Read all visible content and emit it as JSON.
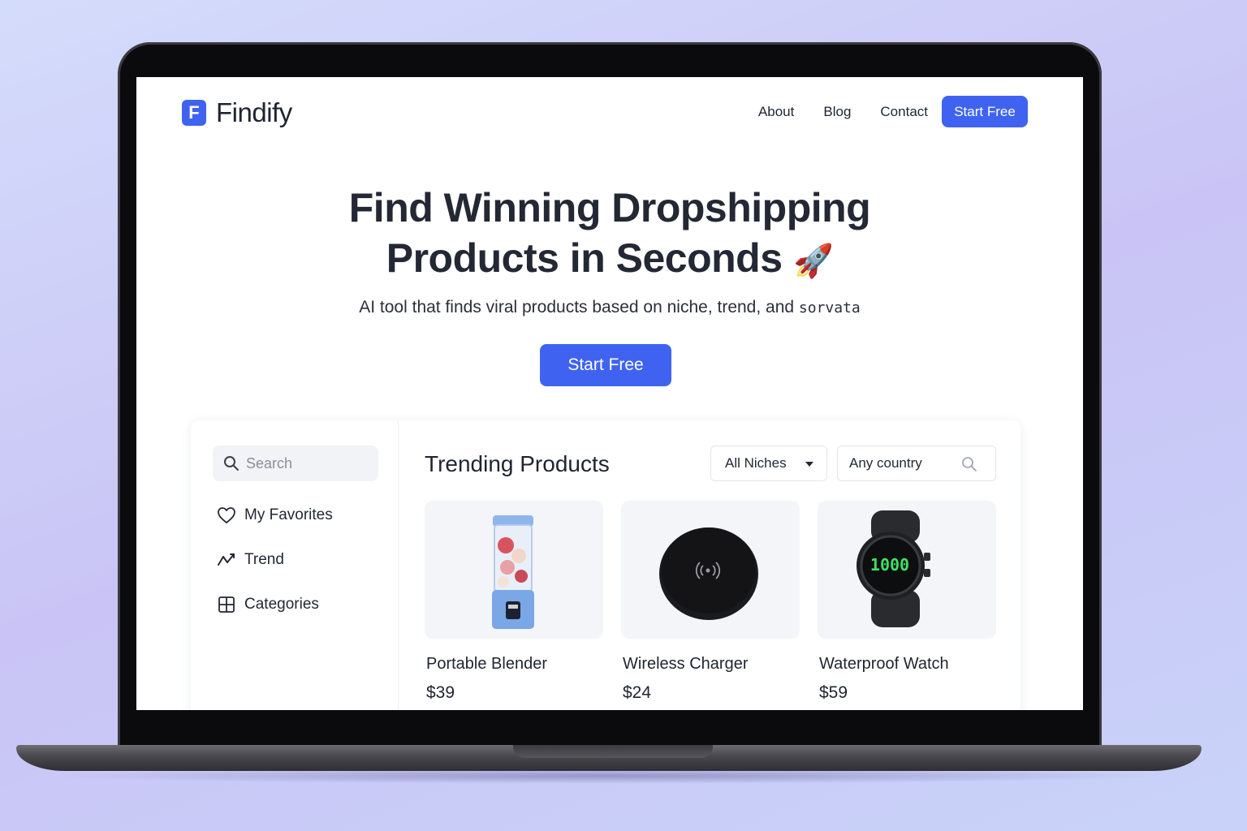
{
  "brand": {
    "logo_letter": "F",
    "name": "Findify",
    "accent": "#3f63f0"
  },
  "nav": {
    "items": [
      {
        "label": "About"
      },
      {
        "label": "Blog"
      },
      {
        "label": "Contact"
      }
    ],
    "cta_label": "Start Free"
  },
  "hero": {
    "title_line1": "Find Winning Dropshipping",
    "title_line2": "Products in Seconds",
    "title_emoji": "🚀",
    "subtitle": "AI tool that finds viral products based on niche, trend, and",
    "subtitle_tail": "sorvata",
    "cta_label": "Start Free"
  },
  "sidebar": {
    "search_placeholder": "Search",
    "items": [
      {
        "label": "My Favorites",
        "icon": "heart-icon"
      },
      {
        "label": "Trend",
        "icon": "trend-icon"
      },
      {
        "label": "Categories",
        "icon": "grid-icon"
      }
    ]
  },
  "main": {
    "title": "Trending Products",
    "niche_select": "All Niches",
    "country_placeholder": "Any country",
    "products": [
      {
        "name": "Portable Blender",
        "price": "$39",
        "image": "blender-image"
      },
      {
        "name": "Wireless Charger",
        "price": "$24",
        "image": "charger-image"
      },
      {
        "name": "Waterproof Watch",
        "price": "$59",
        "image": "watch-image",
        "display": "1000"
      }
    ]
  }
}
